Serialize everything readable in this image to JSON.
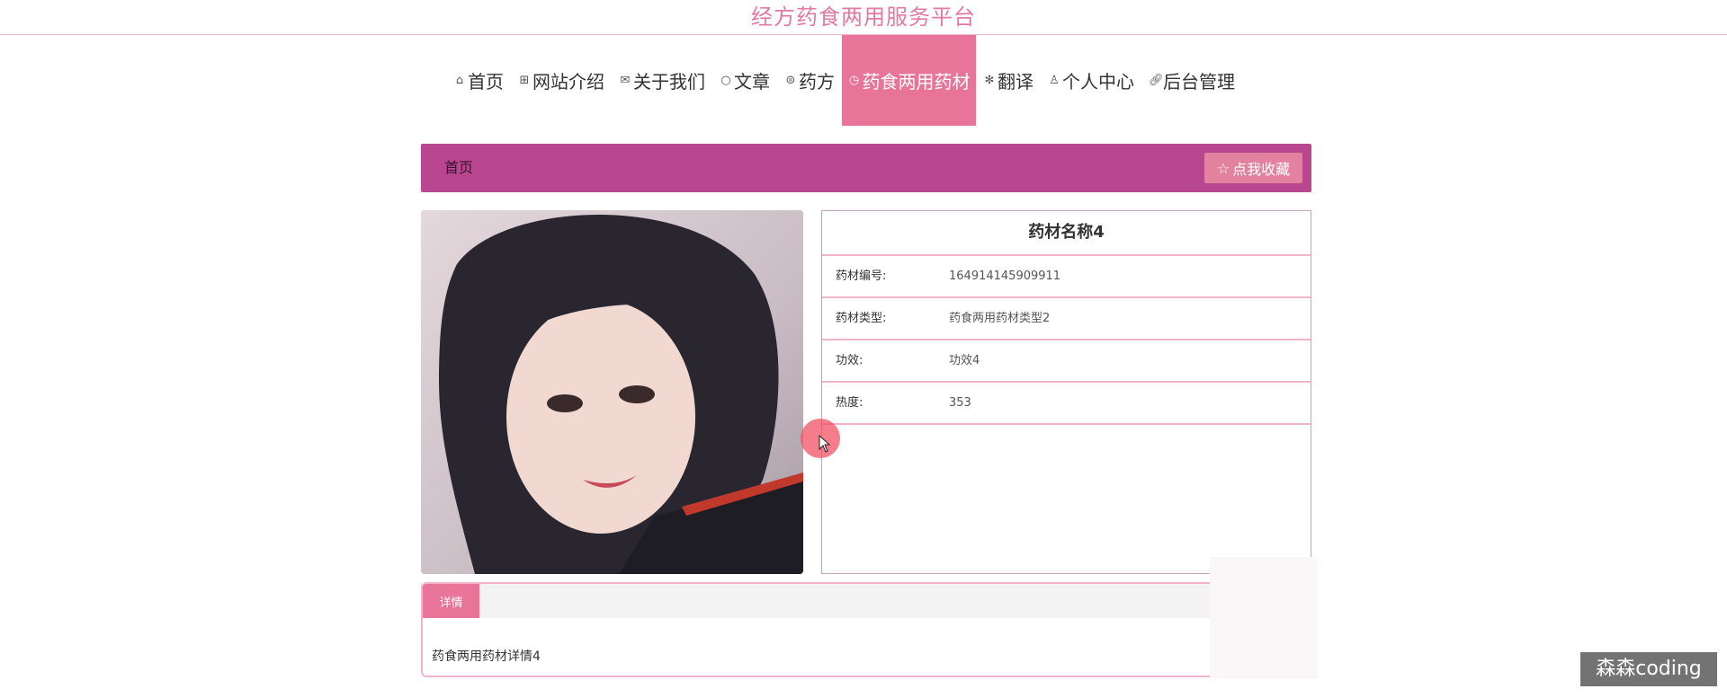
{
  "header": {
    "site_title": "经方药食两用服务平台"
  },
  "nav": {
    "items": [
      {
        "icon": "home-icon",
        "label": "首页"
      },
      {
        "icon": "grid-icon",
        "label": "网站介绍"
      },
      {
        "icon": "mail-icon",
        "label": "关于我们"
      },
      {
        "icon": "circle-icon",
        "label": "文章"
      },
      {
        "icon": "dots-circle-icon",
        "label": "药方"
      },
      {
        "icon": "clock-icon",
        "label": "药食两用药材",
        "active": true
      },
      {
        "icon": "asterisk-icon",
        "label": "翻译"
      },
      {
        "icon": "user-icon",
        "label": "个人中心"
      },
      {
        "icon": "link-icon",
        "label": "后台管理"
      }
    ]
  },
  "breadcrumb": {
    "home": "首页"
  },
  "favorite_button": {
    "label": "点我收藏",
    "icon": "star-icon"
  },
  "info": {
    "title": "药材名称4",
    "rows": [
      {
        "label": "药材编号:",
        "value": "164914145909911"
      },
      {
        "label": "药材类型:",
        "value": "药食两用药材类型2"
      },
      {
        "label": "功效:",
        "value": "功效4"
      },
      {
        "label": "热度:",
        "value": "353"
      }
    ]
  },
  "detail": {
    "tab_label": "详情",
    "content": "药食两用药材详情4"
  },
  "watermark": "森森coding",
  "colors": {
    "brand_pink": "#e8749a",
    "crumb_bar": "#b8478f",
    "title_pink": "#e37aa1",
    "border_pink": "#f1b4c9"
  }
}
